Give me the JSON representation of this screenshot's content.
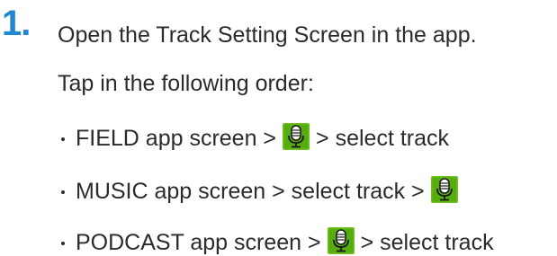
{
  "step": {
    "number": "1.",
    "accent_color": "#1e88d2"
  },
  "lines": {
    "intro": "Open the Track Setting Screen in the app.",
    "order": "Tap in the following order:"
  },
  "bullets": [
    {
      "before": "FIELD app screen >",
      "icon": "microphone-icon",
      "after": "> select track"
    },
    {
      "before": "MUSIC app screen > select track >",
      "icon": "microphone-icon",
      "after": ""
    },
    {
      "before": "PODCAST app screen >",
      "icon": "microphone-icon",
      "after": "> select track"
    }
  ]
}
